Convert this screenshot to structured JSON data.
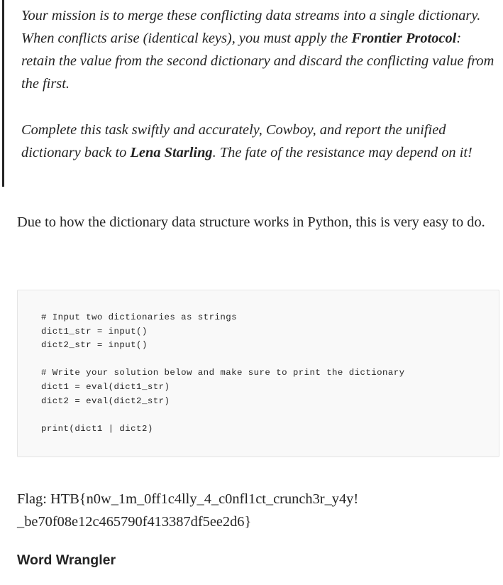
{
  "blockquote": {
    "paragraph1": {
      "before": "Your mission is to merge these conflicting data streams into a single dictionary. When conflicts arise (identical keys), you must apply the ",
      "bold": "Frontier Protocol",
      "after": ": retain the value from the second dictionary and discard the conflicting value from the first."
    },
    "paragraph2": {
      "before": "Complete this task swiftly and accurately, Cowboy, and report the unified dictionary back to ",
      "bold": "Lena Starling",
      "after": ". The fate of the resistance may depend on it!"
    }
  },
  "explanation": "Due to how the dictionary data structure works in Python, this is very easy to do.",
  "code": {
    "lines": [
      "# Input two dictionaries as strings",
      "dict1_str = input()",
      "dict2_str = input()",
      "",
      "# Write your solution below and make sure to print the dictionary",
      "dict1 = eval(dict1_str)",
      "dict2 = eval(dict2_str)",
      "",
      "print(dict1 | dict2)"
    ]
  },
  "flag": {
    "line1": "Flag: HTB{n0w_1m_0ff1c4lly_4_c0nfl1ct_crunch3r_y4y!",
    "line2": "_be70f08e12c465790f413387df5ee2d6}"
  },
  "next_heading": "Word Wrangler"
}
